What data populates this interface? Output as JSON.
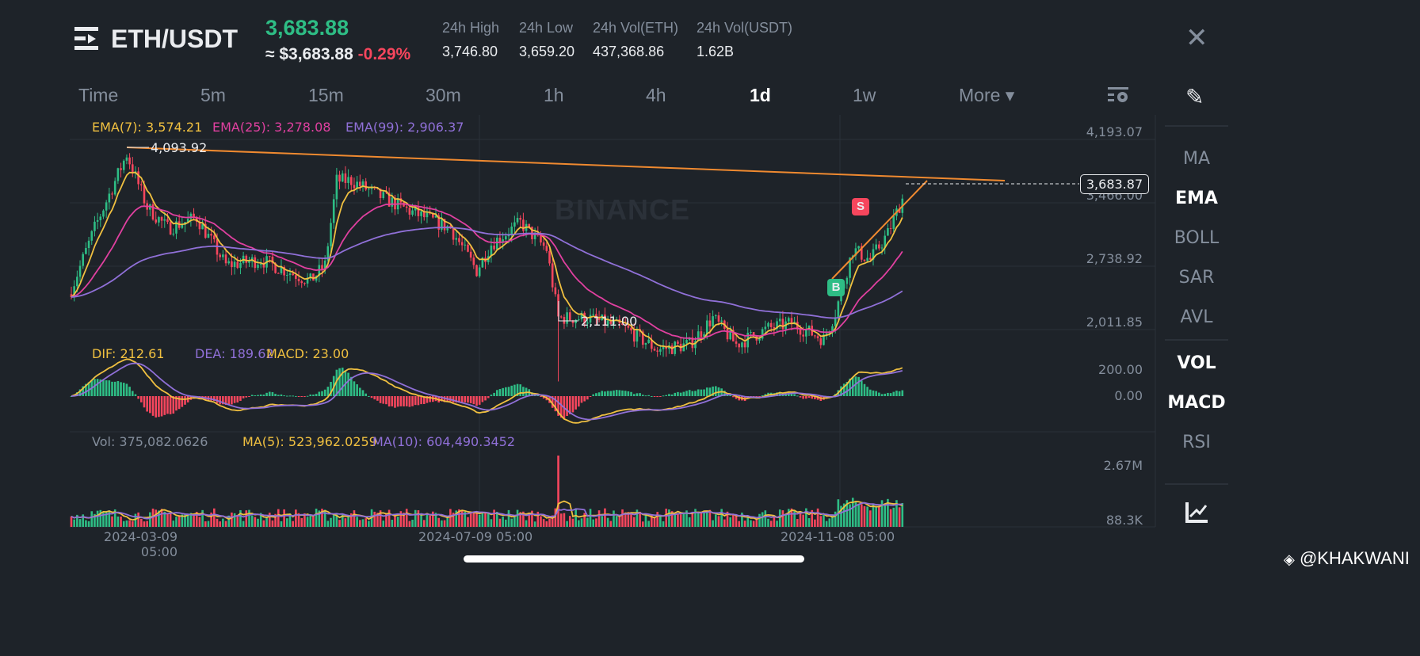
{
  "header": {
    "pair": "ETH/USDT",
    "price": "3,683.88",
    "usd_price": "≈ $3,683.88",
    "change": "-0.29%",
    "stats": [
      {
        "label": "24h High",
        "value": "3,746.80"
      },
      {
        "label": "24h Low",
        "value": "3,659.20"
      },
      {
        "label": "24h Vol(ETH)",
        "value": "437,368.86"
      },
      {
        "label": "24h Vol(USDT)",
        "value": "1.62B"
      }
    ],
    "close_icon": "close-icon"
  },
  "timeframes": [
    "Time",
    "5m",
    "15m",
    "30m",
    "1h",
    "4h",
    "1d",
    "1w",
    "More ▾"
  ],
  "active_timeframe": "1d",
  "indicators": {
    "main": [
      "MA",
      "EMA",
      "BOLL",
      "SAR",
      "AVL"
    ],
    "sub": [
      "VOL",
      "MACD",
      "RSI"
    ],
    "active": [
      "EMA",
      "VOL",
      "MACD"
    ]
  },
  "legends": {
    "ema7": "EMA(7): 3,574.21",
    "ema25": "EMA(25): 3,278.08",
    "ema99": "EMA(99): 2,906.37",
    "dif": "DIF: 212.61",
    "dea": "DEA: 189.62",
    "macd": "MACD: 23.00",
    "vol": "Vol: 375,082.0626",
    "ma5": "MA(5): 523,962.0259",
    "ma10": "MA(10): 604,490.3452"
  },
  "axis": {
    "price": [
      "4,193.07",
      "3,466.00",
      "2,738.92",
      "2,011.85"
    ],
    "macd": [
      "200.00",
      "0.00"
    ],
    "volume": [
      "2.67M",
      "88.3K"
    ],
    "dates": [
      "2024-03-09 05:00",
      "2024-07-09 05:00",
      "2024-11-08 05:00"
    ]
  },
  "annotations": {
    "high": "4,093.92",
    "low": "2,111.00",
    "last_price": "3,683.87",
    "buy_marker": "B",
    "sell_marker": "S",
    "watermark": "BINANCE"
  },
  "footer": {
    "credit": "@KHAKWANI"
  },
  "colors": {
    "up": "#2ebd85",
    "down": "#f6465d",
    "ema7": "#f0c040",
    "ema25": "#e040a0",
    "ema99": "#9070d8",
    "trend": "#f08a30"
  },
  "chart_data": {
    "type": "candlestick",
    "title": "ETH/USDT 1d",
    "y_range": [
      2011.85,
      4193.07
    ],
    "price_path": [
      [
        0,
        2902
      ],
      [
        8,
        3430
      ],
      [
        19,
        4066
      ],
      [
        26,
        3611
      ],
      [
        33,
        3430
      ],
      [
        43,
        3520
      ],
      [
        53,
        3112
      ],
      [
        65,
        3157
      ],
      [
        82,
        2975
      ],
      [
        87,
        3112
      ],
      [
        91,
        3839
      ],
      [
        96,
        3839
      ],
      [
        106,
        3702
      ],
      [
        117,
        3566
      ],
      [
        130,
        3430
      ],
      [
        139,
        3066
      ],
      [
        144,
        3293
      ],
      [
        154,
        3475
      ],
      [
        163,
        3248
      ],
      [
        167,
        2657
      ],
      [
        177,
        2657
      ],
      [
        190,
        2566
      ],
      [
        201,
        2384
      ],
      [
        212,
        2430
      ],
      [
        220,
        2657
      ],
      [
        228,
        2430
      ],
      [
        239,
        2566
      ],
      [
        247,
        2611
      ],
      [
        258,
        2475
      ],
      [
        262,
        2702
      ],
      [
        268,
        3248
      ],
      [
        274,
        3157
      ],
      [
        280,
        3384
      ],
      [
        285,
        3683.87
      ]
    ],
    "volume_spike_index": 167
  }
}
